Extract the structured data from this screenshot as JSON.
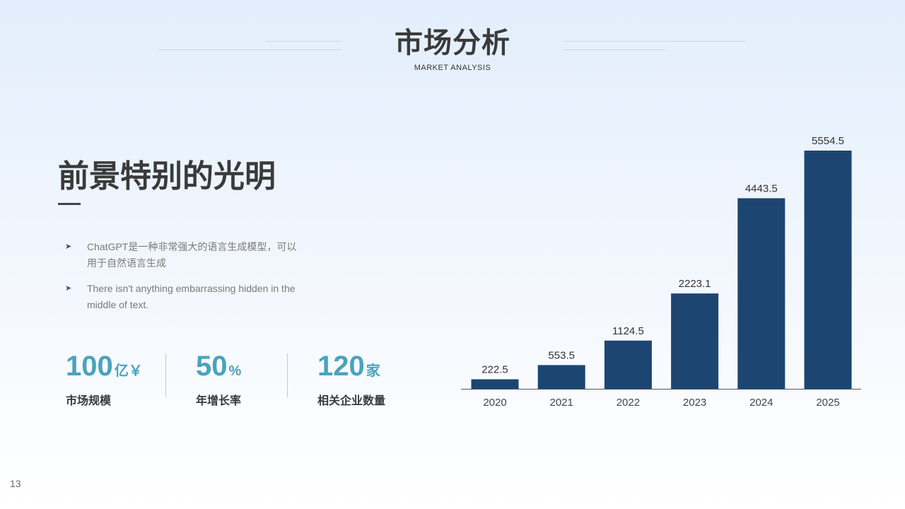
{
  "header": {
    "title": "市场分析",
    "subtitle": "MARKET ANALYSIS"
  },
  "content": {
    "headline": "前景特别的光明",
    "bullets": [
      {
        "icon": "arrow-bullet-icon",
        "text": "ChatGPT是一种非常强大的语言生成模型，可以用于自然语言生成"
      },
      {
        "icon": "arrow-bullet-icon",
        "text": "There isn't anything embarrassing hidden in the middle of text."
      }
    ],
    "stats": [
      {
        "value": "100",
        "unit": "亿￥",
        "label": "市场规模"
      },
      {
        "value": "50",
        "unit": "%",
        "label": "年增长率"
      },
      {
        "value": "120",
        "unit": "家",
        "label": "相关企业数量"
      }
    ]
  },
  "page_number": "13",
  "colors": {
    "bar": "#1c4671",
    "accent": "#4aa3bd",
    "bullet_arrow": "#2a4f9c"
  },
  "chart_data": {
    "type": "bar",
    "categories": [
      "2020",
      "2021",
      "2022",
      "2023",
      "2024",
      "2025"
    ],
    "values": [
      222.5,
      553.5,
      1124.5,
      2223.1,
      4443.5,
      5554.5
    ],
    "title": "",
    "xlabel": "",
    "ylabel": "",
    "ylim": [
      0,
      5554.5
    ],
    "data_labels": true,
    "grid": false,
    "legend": "none"
  }
}
